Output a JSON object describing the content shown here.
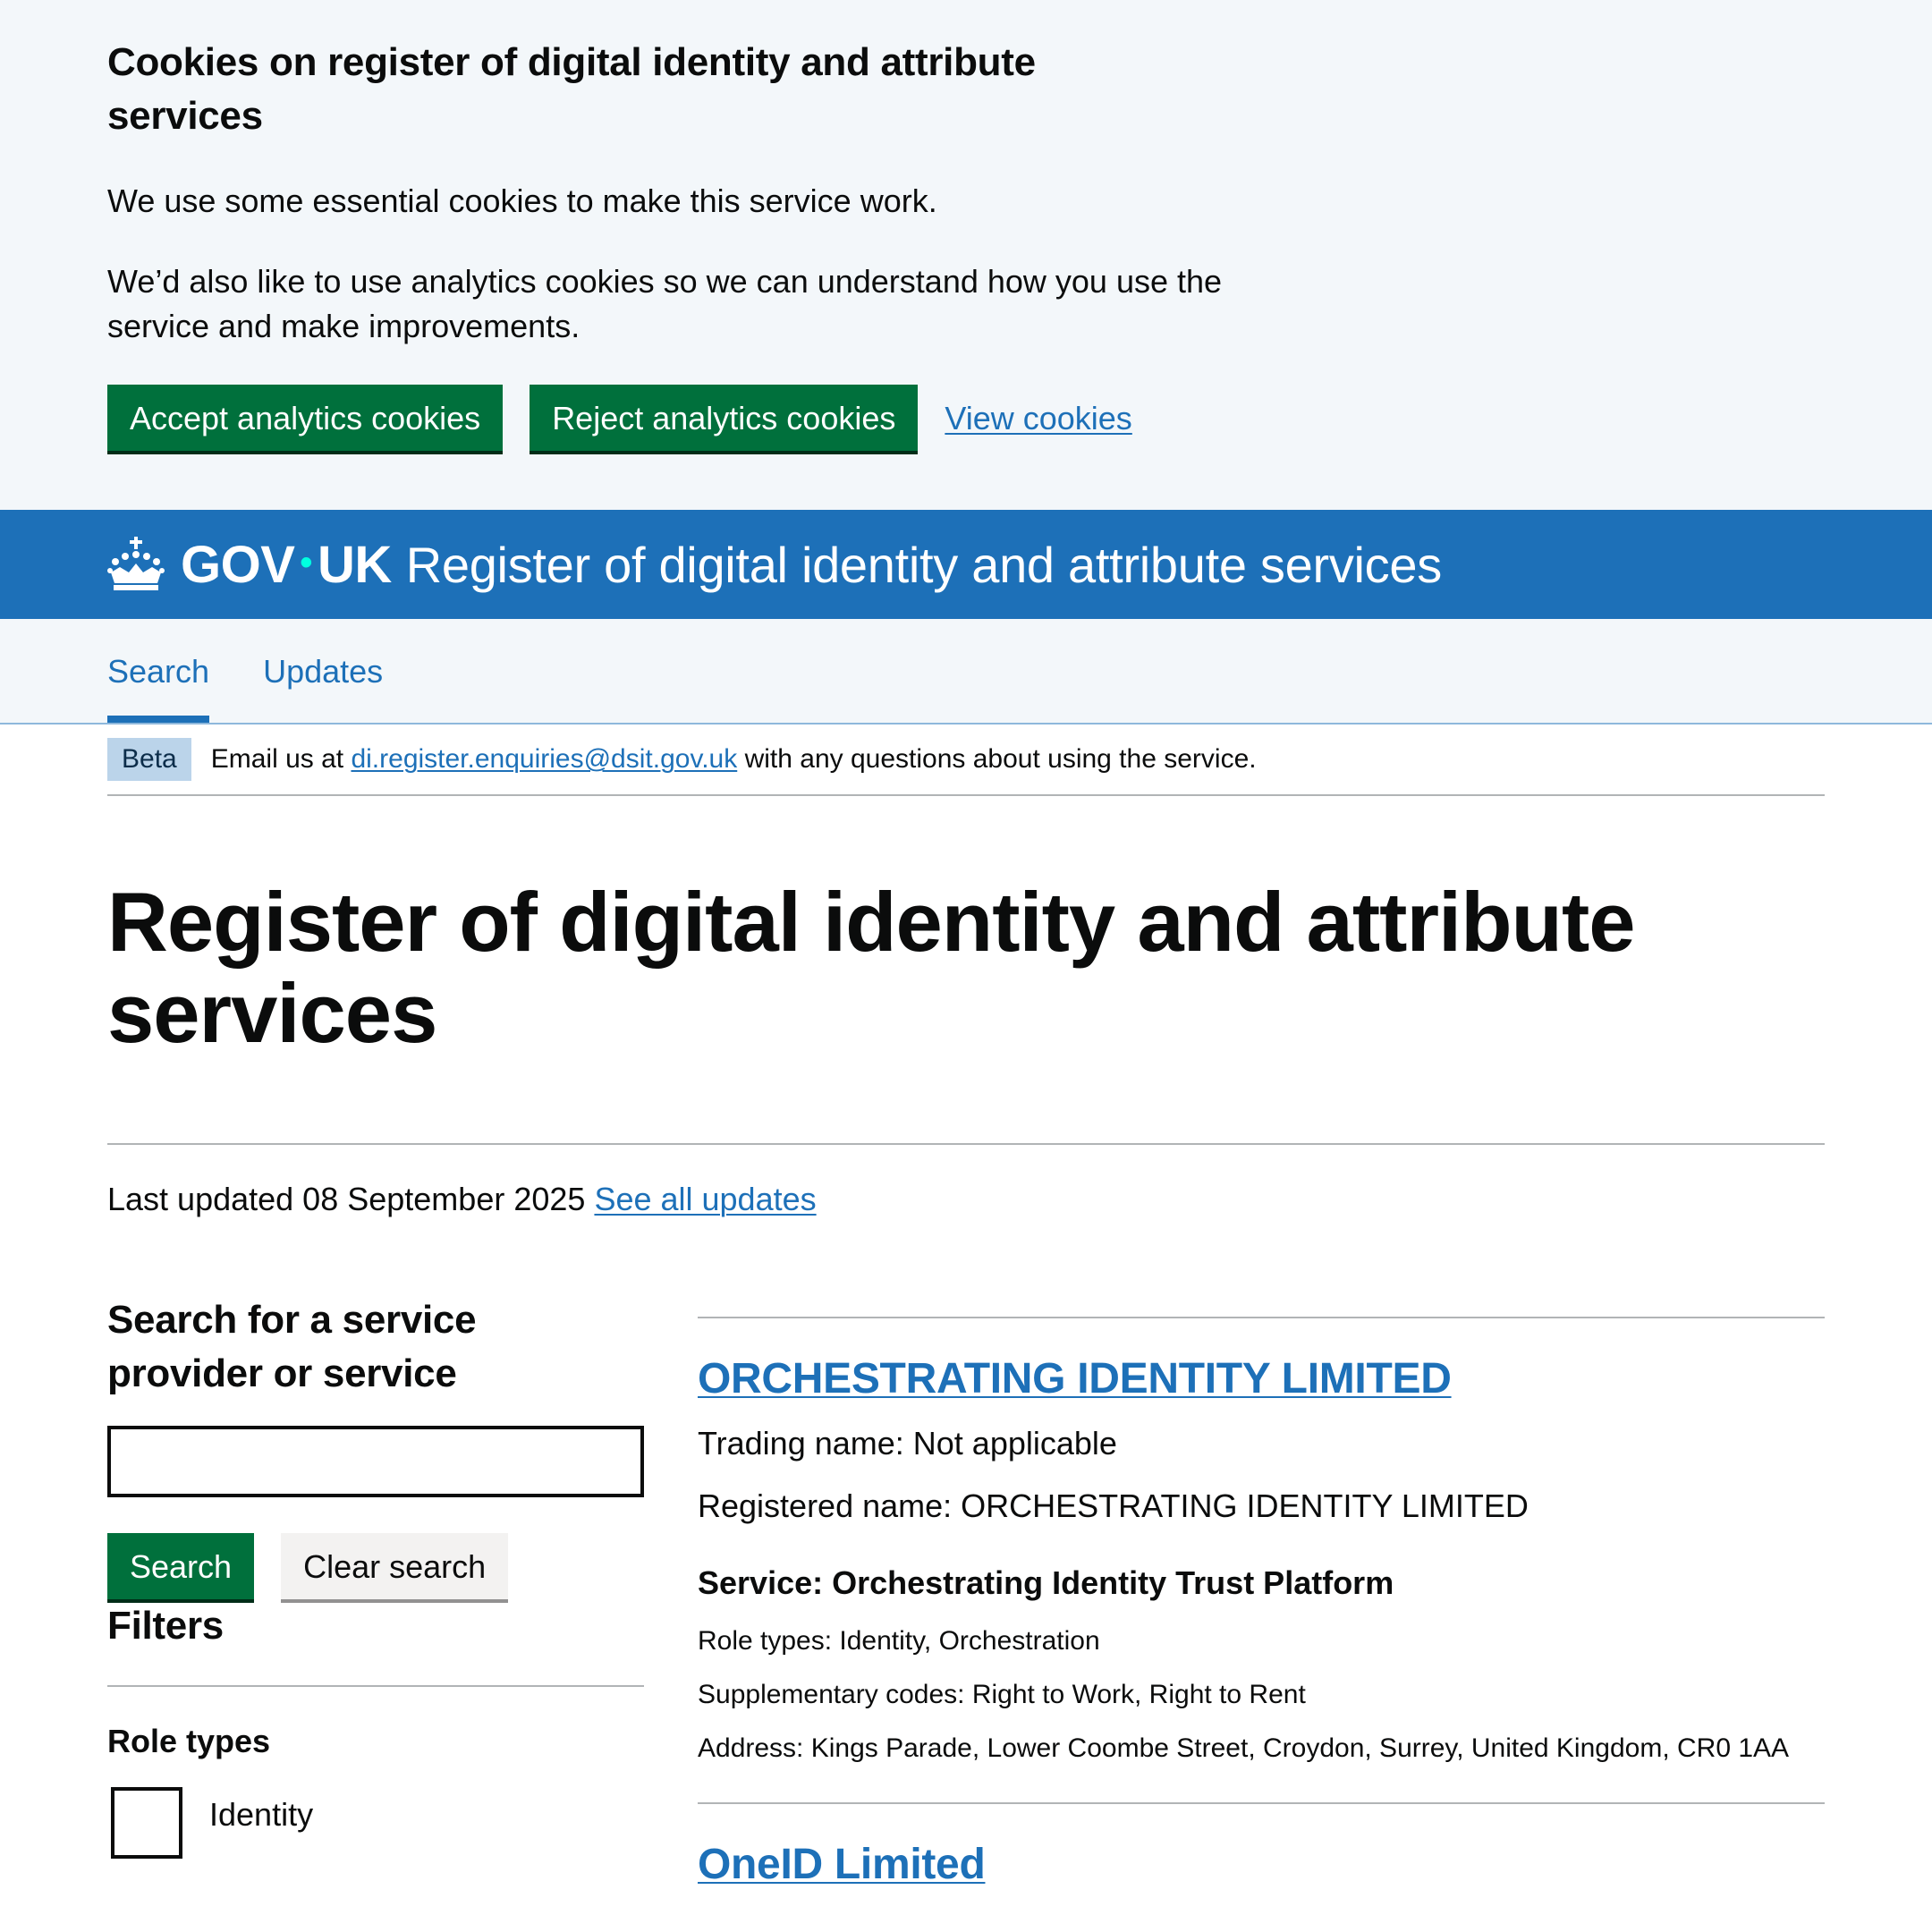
{
  "cookie_banner": {
    "heading": "Cookies on register of digital identity and attribute services",
    "paragraph_1": "We use some essential cookies to make this service work.",
    "paragraph_2": "We’d also like to use analytics cookies so we can understand how you use the service and make improvements.",
    "accept_label": "Accept analytics cookies",
    "reject_label": "Reject analytics cookies",
    "view_label": "View cookies"
  },
  "header": {
    "logo_gov": "GOV",
    "logo_dot": "•",
    "logo_uk": "UK",
    "service_name": "Register of digital identity and attribute services"
  },
  "nav": {
    "items": [
      {
        "label": "Search"
      },
      {
        "label": "Updates"
      }
    ]
  },
  "phase_banner": {
    "tag": "Beta",
    "text_before": "Email us at",
    "email": "di.register.enquiries@dsit.gov.uk",
    "text_after": "with any questions about using the service."
  },
  "page": {
    "title": "Register of digital identity and attribute services",
    "last_updated_text": "Last updated 08 September 2025",
    "see_all_updates": "See all updates"
  },
  "search": {
    "heading": "Search for a service provider or service",
    "input_value": "",
    "search_button": "Search",
    "clear_button": "Clear search"
  },
  "filters": {
    "heading": "Filters",
    "role_types_heading": "Role types",
    "first_option": "Identity"
  },
  "results": [
    {
      "name": "ORCHESTRATING IDENTITY LIMITED",
      "trading_name": "Trading name: Not applicable",
      "registered_name": "Registered name: ORCHESTRATING IDENTITY LIMITED",
      "service": "Service: Orchestrating Identity Trust Platform",
      "role_types": "Role types: Identity, Orchestration",
      "supplementary_codes": "Supplementary codes: Right to Work, Right to Rent",
      "address": "Address: Kings Parade, Lower Coombe Street, Croydon, Surrey, United Kingdom, CR0 1AA"
    },
    {
      "name": "OneID Limited"
    }
  ],
  "colors": {
    "brand_blue": "#1d70b8",
    "button_green": "#00703c",
    "banner_bg": "#f3f7fa",
    "text": "#0b0c0c",
    "beta_tag_bg": "#bbd4ea"
  }
}
